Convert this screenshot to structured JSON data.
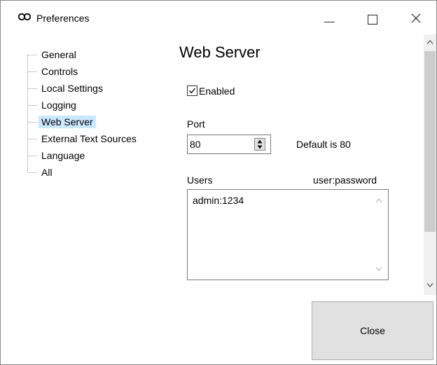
{
  "window": {
    "title": "Preferences",
    "buttons": {
      "minimize": "minimize",
      "maximize": "maximize",
      "close": "close"
    }
  },
  "tree": {
    "items": [
      {
        "label": "General",
        "selected": false
      },
      {
        "label": "Controls",
        "selected": false
      },
      {
        "label": "Local Settings",
        "selected": false
      },
      {
        "label": "Logging",
        "selected": false
      },
      {
        "label": "Web Server",
        "selected": true
      },
      {
        "label": "External Text Sources",
        "selected": false
      },
      {
        "label": "Language",
        "selected": false
      },
      {
        "label": "All",
        "selected": false
      }
    ]
  },
  "panel": {
    "heading": "Web Server",
    "enabled": {
      "label": "Enabled",
      "checked": true
    },
    "port": {
      "label": "Port",
      "value": "80",
      "hint": "Default is 80"
    },
    "users": {
      "label": "Users",
      "format_hint": "user:password",
      "value": "admin:1234"
    }
  },
  "footer": {
    "close_label": "Close"
  },
  "colors": {
    "selection": "#cce8ff",
    "button_face": "#e1e1e1",
    "scroll_thumb": "#cdcdcd"
  },
  "icons": {
    "app": "app-logo-icon",
    "check": "check-icon",
    "spin_up": "triangle-up-icon",
    "spin_down": "triangle-down-icon",
    "scroll_up": "chevron-up-icon",
    "scroll_down": "chevron-down-icon"
  }
}
